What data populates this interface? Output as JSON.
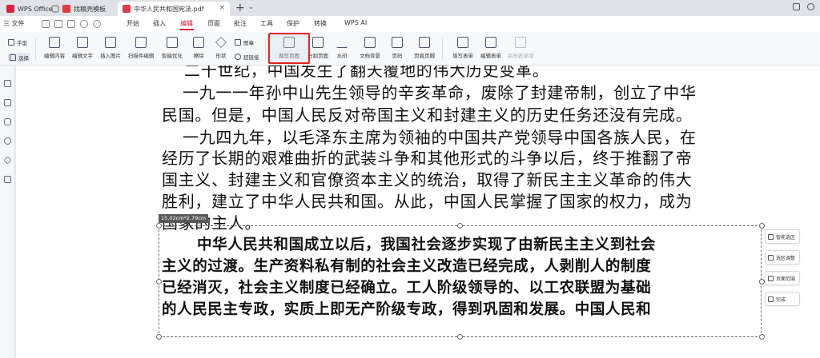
{
  "tabs": {
    "wps": "WPS Office",
    "template": "找稿壳模板",
    "document": "中华人民共和国宪法.pdf"
  },
  "menu": {
    "file": "三 文件",
    "items": [
      "开始",
      "插入",
      "编辑",
      "页面",
      "批注",
      "工具",
      "保护",
      "转换",
      "WPS AI"
    ],
    "active": "编辑"
  },
  "ribbon": {
    "hand": "手型",
    "select": "选择",
    "edit_content": "编辑内容",
    "edit_text": "编辑文字",
    "insert_image": "插入图片",
    "scan_edit": "扫描件编辑",
    "smart_optimize": "智能优化",
    "erase": "擦除",
    "shape": "形状",
    "stamp": "图章",
    "hyperlink": "超链接",
    "crop_page": "裁剪页面",
    "split_page": "分割页面",
    "watermark": "水印",
    "header_footer": "文档背景",
    "page_number": "页码",
    "page_border": "页眉页脚",
    "fill_form": "填写表单",
    "edit_form": "编辑表单",
    "highlight_form": "高亮表单域"
  },
  "document": {
    "lines": [
      "二十世纪，中国发生了翻天覆地的伟大历史变革。",
      "一九一一年孙中山先生领导的辛亥革命，废除了封建帝制，创立了中华",
      "民国。但是，中国人民反对帝国主义和封建主义的历史任务还没有完成。",
      "一九四九年，以毛泽东主席为领袖的中国共产党领导中国各族人民，在",
      "经历了长期的艰难曲折的武装斗争和其他形式的斗争以后，终于推翻了帝",
      "国主义、封建主义和官僚资本主义的统治，取得了新民主主义革命的伟大",
      "胜利，建立了中华人民共和国。从此，中国人民掌握了国家的权力，成为",
      "国家的主人。"
    ],
    "selected_lines": [
      "中华人民共和国成立以后，我国社会逐步实现了由新民主主义到社会",
      "主义的过渡。生产资料私有制的社会主义改造已经完成，人剥削人的制度",
      "已经消灭，社会主义制度已经确立。工人阶级领导的、以工农联盟为基础",
      "的人民民主专政，实质上即无产阶级专政，得到巩固和发展。中国人民和"
    ]
  },
  "selection": {
    "size_tip": "15.02cm*2.79cm"
  },
  "crop_panel": {
    "smart_select": "智能选区",
    "adjust_select": "选区调整",
    "page_range": "页面范围",
    "done": "完成"
  }
}
